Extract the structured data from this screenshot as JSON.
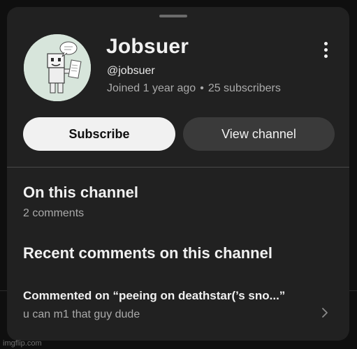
{
  "channel": {
    "name": "Jobsuer",
    "handle": "@jobsuer",
    "joined": "Joined 1 year ago",
    "separator": "•",
    "subscribers": "25 subscribers"
  },
  "buttons": {
    "subscribe_label": "Subscribe",
    "view_channel_label": "View channel"
  },
  "section_on_channel": {
    "title": "On this channel",
    "count": "2 comments"
  },
  "section_recent": {
    "title": "Recent comments on this channel",
    "comment": {
      "title": "Commented on “peeing on deathstar(’s sno...”",
      "text": "u can m1 that guy dude"
    }
  },
  "watermark": "imgflip.com",
  "icons": {
    "menu": "more-vert-icon",
    "chevron": "chevron-right-icon"
  },
  "colors": {
    "sheet_background": "#212121",
    "page_background": "#0f0f0f",
    "subscribe_button": "#f1f1f1",
    "view_button": "#3a3a3a",
    "secondary_text": "#aaaaaa"
  }
}
